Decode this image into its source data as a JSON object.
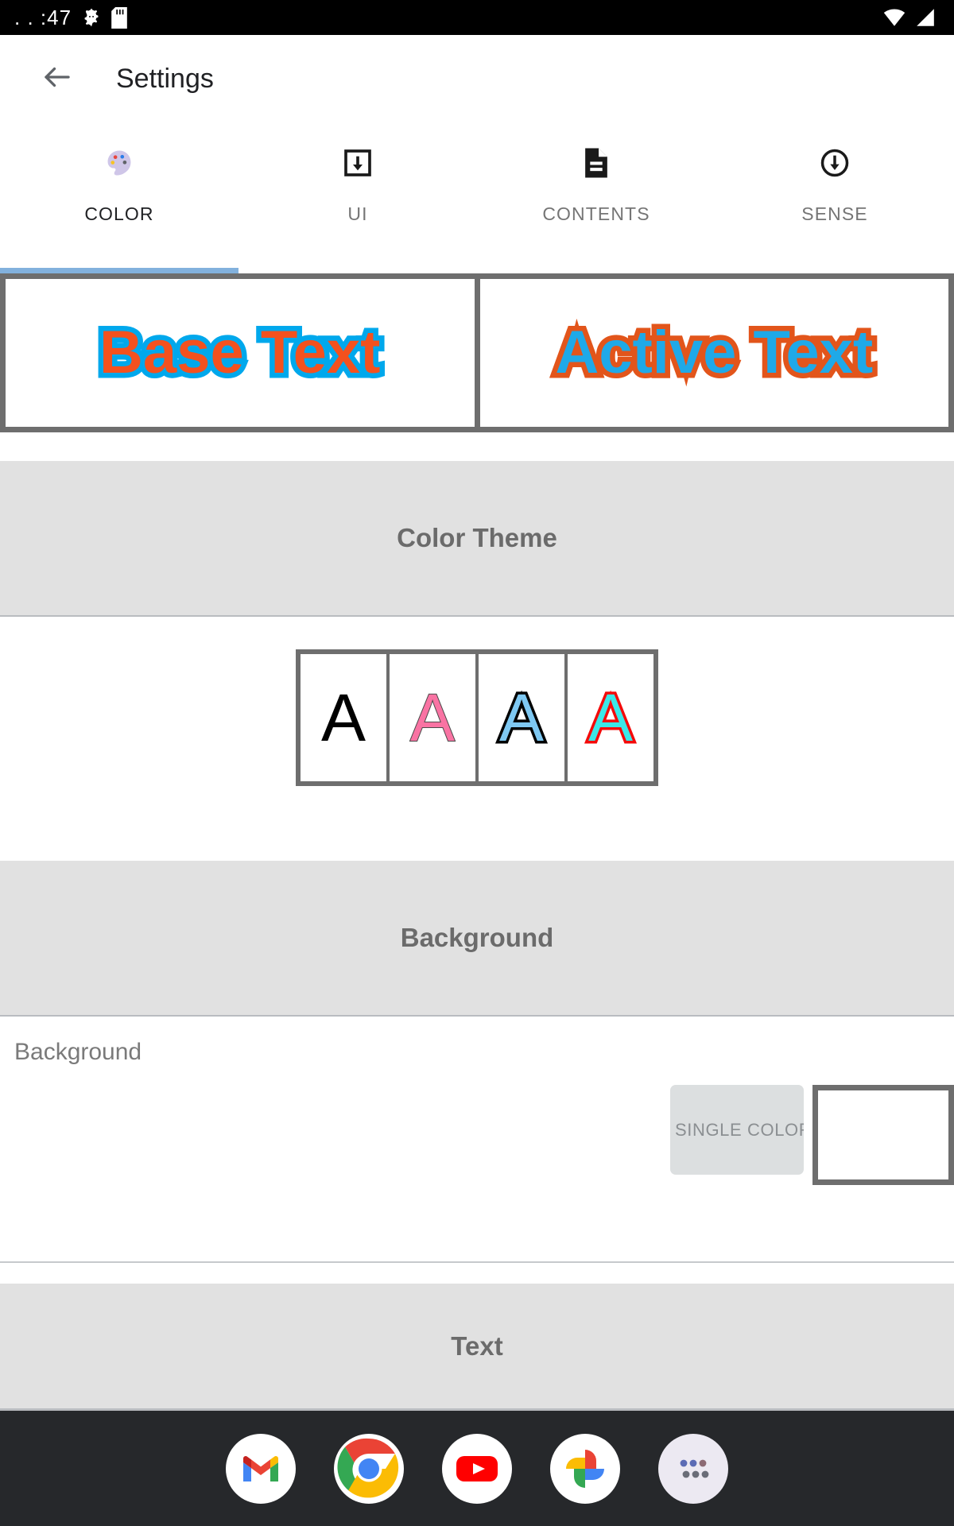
{
  "status_bar": {
    "time": ". . :47",
    "icons": [
      "android-gear-icon",
      "sd-card-icon",
      "wifi-icon",
      "signal-icon"
    ]
  },
  "app_bar": {
    "back_icon": "arrow-back-icon",
    "title": "Settings"
  },
  "tabs": [
    {
      "label": "COLOR",
      "icon": "palette-icon",
      "active": true
    },
    {
      "label": "UI",
      "icon": "download-box-icon",
      "active": false
    },
    {
      "label": "CONTENTS",
      "icon": "document-icon",
      "active": false
    },
    {
      "label": "SENSE",
      "icon": "circle-down-arrow-icon",
      "active": false
    }
  ],
  "preview": {
    "base_text": "Base Text",
    "active_text": "Active Text",
    "base_fill": "#F4511E",
    "base_stroke": "#00A8EC",
    "active_fill": "#1FA9E8",
    "active_stroke": "#E2551B"
  },
  "sections": {
    "color_theme": {
      "title": "Color Theme",
      "swatches": [
        {
          "letter": "A",
          "fill": "#000000",
          "stroke": "none"
        },
        {
          "letter": "A",
          "fill": "#F973A3",
          "stroke": "#4a4a4a"
        },
        {
          "letter": "A",
          "fill": "#7EC8F2",
          "stroke": "#000000"
        },
        {
          "letter": "A",
          "fill": "#3BE8E8",
          "stroke": "#F40A0A"
        }
      ]
    },
    "background": {
      "title": "Background",
      "row_label": "Background",
      "mode_button": "SINGLE COLOR",
      "swatch_color": "#FFFFFF"
    },
    "text": {
      "title": "Text"
    }
  },
  "dock": {
    "items": [
      {
        "name": "gmail",
        "label": "Gmail"
      },
      {
        "name": "chrome",
        "label": "Chrome"
      },
      {
        "name": "youtube",
        "label": "YouTube"
      },
      {
        "name": "photos",
        "label": "Photos"
      },
      {
        "name": "app-drawer",
        "label": "All apps"
      }
    ]
  },
  "theme_colors": {
    "tab_indicator": "#82b1dd",
    "section_bg": "#e1e1e1",
    "border_grey": "#6e6e6e",
    "dock_bg": "#26282b"
  }
}
